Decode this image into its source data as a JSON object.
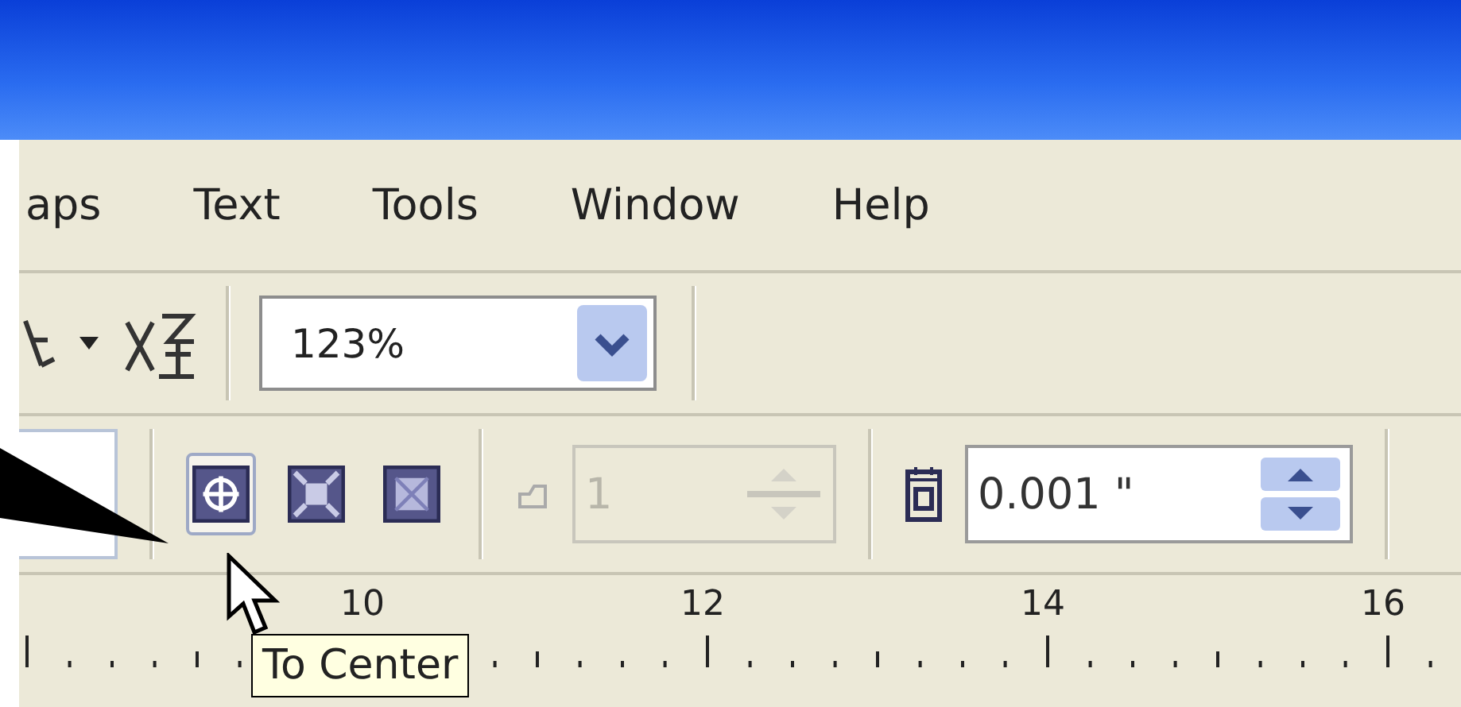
{
  "menu_bar": {
    "items": [
      "aps",
      "Text",
      "Tools",
      "Window",
      "Help"
    ]
  },
  "toolbar_top": {
    "zoom_combo": {
      "value": "123%"
    }
  },
  "toolbar_property": {
    "align_buttons": [
      {
        "kind": "center",
        "selected": true
      },
      {
        "kind": "grid",
        "selected": false
      },
      {
        "kind": "edges",
        "selected": false
      }
    ],
    "copies_spinner": {
      "value": "1",
      "disabled": true
    },
    "nudge_spinner": {
      "value": "0.001 \"",
      "disabled": false
    }
  },
  "ruler": {
    "labels": [
      "10",
      "12",
      "14",
      "16"
    ]
  },
  "tooltip": {
    "text": "To Center"
  }
}
